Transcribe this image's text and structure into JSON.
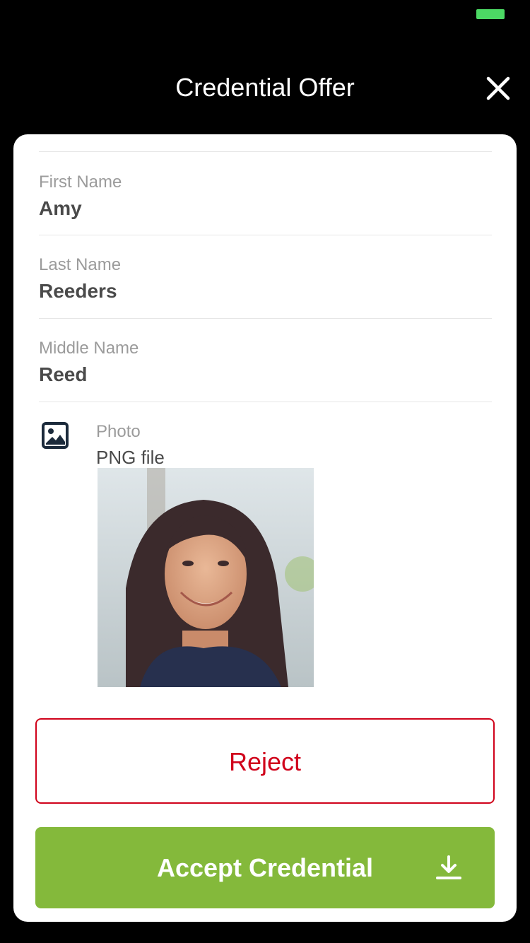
{
  "header": {
    "title": "Credential Offer",
    "close_icon": "close-icon"
  },
  "status_bar": {
    "battery_color": "#4cd964"
  },
  "fields": [
    {
      "label": "First Name",
      "value": "Amy"
    },
    {
      "label": "Last Name",
      "value": "Reeders"
    },
    {
      "label": "Middle Name",
      "value": "Reed"
    }
  ],
  "photo": {
    "icon": "image-icon",
    "label": "Photo",
    "type": "PNG file"
  },
  "actions": {
    "reject_label": "Reject",
    "accept_label": "Accept Credential",
    "accept_icon": "download-icon"
  },
  "colors": {
    "reject": "#d0021b",
    "accept": "#84b93b",
    "label": "#9b9b9b",
    "value": "#4a4a4a"
  }
}
